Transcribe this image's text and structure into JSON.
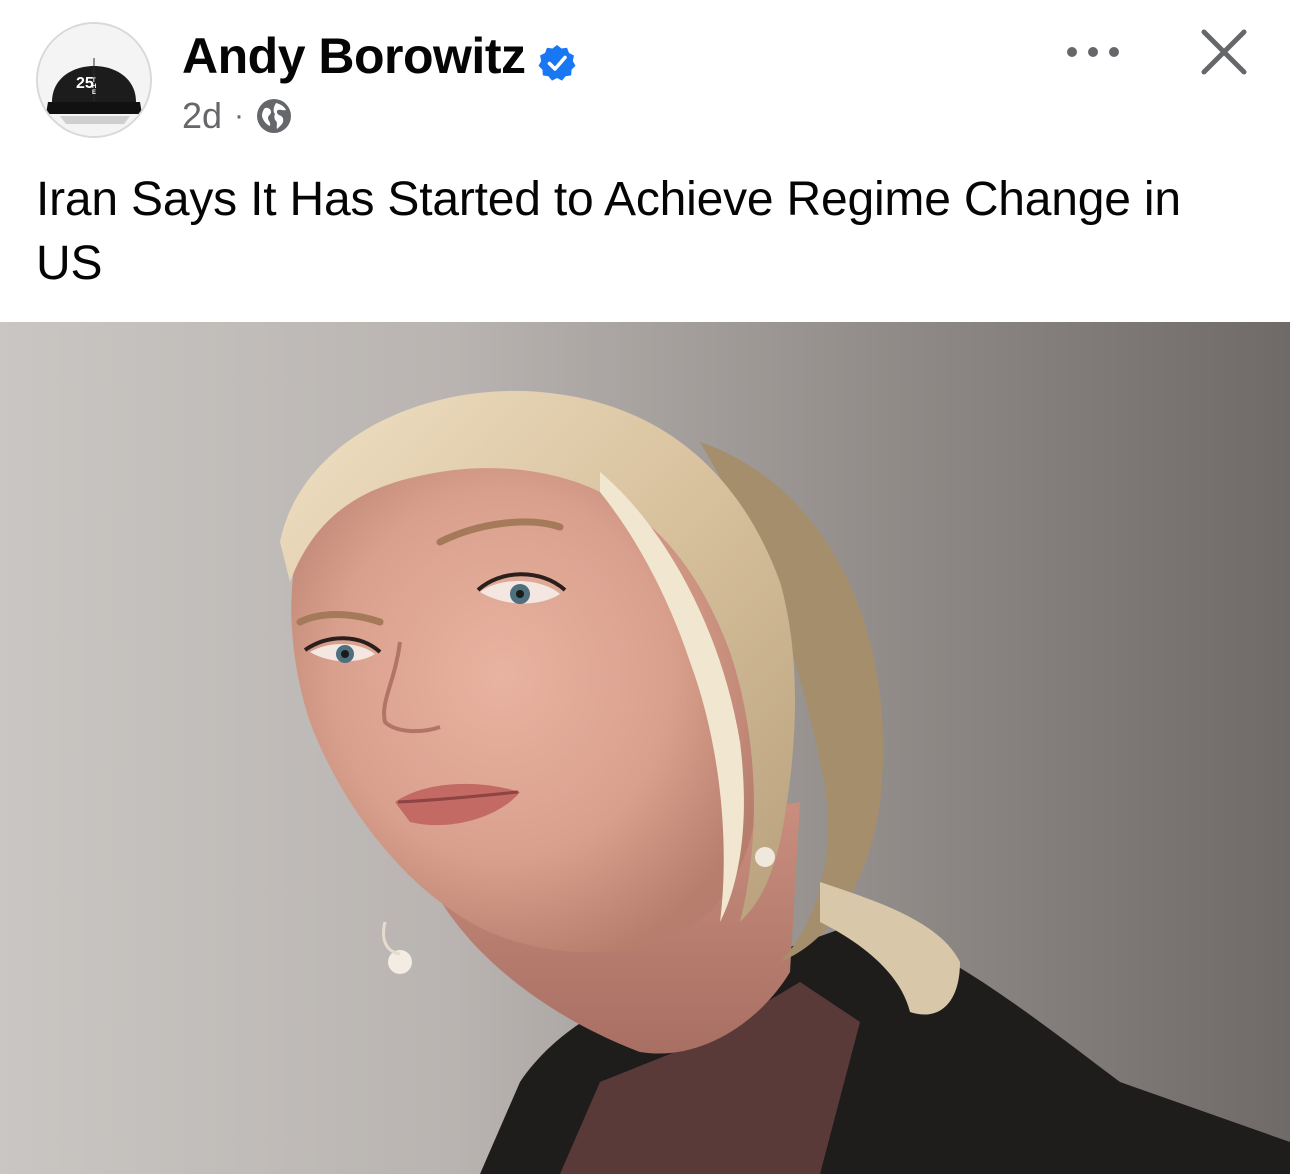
{
  "post": {
    "author": {
      "name": "Andy Borowitz",
      "verified": true,
      "avatar_icon": "black-cap-avatar",
      "avatar_cap_text": "25"
    },
    "timestamp": "2d",
    "separator": "·",
    "audience_icon": "globe-icon",
    "more_icon": "more-options-icon",
    "close_icon": "close-icon",
    "text": "Iran Says It Has Started to Achieve Regime Change in US",
    "image": {
      "description_icon": "photo",
      "subject": "woman-portrait"
    }
  },
  "colors": {
    "verified_blue": "#1877f2",
    "meta_gray": "#65676b",
    "text": "#050505"
  }
}
